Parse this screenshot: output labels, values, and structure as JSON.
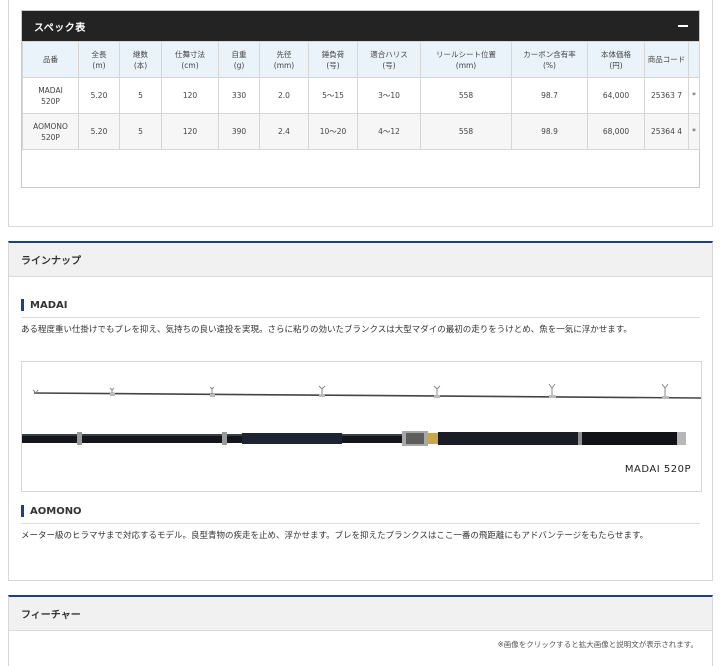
{
  "spec": {
    "title": "スペック表",
    "toggle_icon": "minus-icon",
    "columns": [
      "品番",
      "全長\n(m)",
      "継数\n(本)",
      "仕舞寸法\n(cm)",
      "自重\n(g)",
      "先径\n(mm)",
      "錘負荷\n(号)",
      "適合ハリス\n(号)",
      "リールシート位置\n(mm)",
      "カーボン含有率\n(%)",
      "本体価格\n(円)",
      "商品コード",
      ""
    ],
    "rows": [
      [
        "MADAI\n520P",
        "5.20",
        "5",
        "120",
        "330",
        "2.0",
        "5～15",
        "3～10",
        "558",
        "98.7",
        "64,000",
        "25363 7",
        "*"
      ],
      [
        "AOMONO\n520P",
        "5.20",
        "5",
        "120",
        "390",
        "2.4",
        "10～20",
        "4～12",
        "558",
        "98.9",
        "68,000",
        "25364 4",
        "*"
      ]
    ]
  },
  "lineup": {
    "title": "ラインナップ",
    "madai": {
      "title": "MADAI",
      "desc": "ある程度重い仕掛けでもブレを抑え、気持ちの良い遠投を実現。さらに粘りの効いたブランクスは大型マダイの最初の走りをうけとめ、魚を一気に浮かせます。",
      "rod_label": "MADAI 520P"
    },
    "aomono": {
      "title": "AOMONO",
      "desc": "メーター級のヒラマサまで対応するモデル。良型青物の疾走を止め、浮かせます。ブレを抑えたブランクスはここ一番の飛距離にもアドバンテージをもたらせます。"
    }
  },
  "feature": {
    "title": "フィーチャー",
    "note": "※画像をクリックすると拡大画像と説明文が表示されます。"
  }
}
